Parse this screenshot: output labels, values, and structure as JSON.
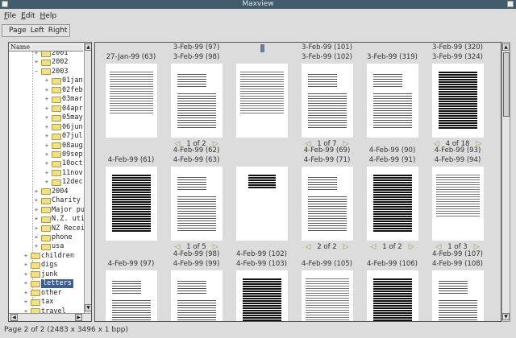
{
  "window": {
    "title": "Maxview"
  },
  "menu": [
    "File",
    "Edit",
    "Help"
  ],
  "toolbar": [
    "Page",
    "Left",
    "Right"
  ],
  "tree": {
    "header": "Name",
    "items": [
      {
        "label": "2001",
        "level": 2
      },
      {
        "label": "2002",
        "level": 2
      },
      {
        "label": "2003",
        "level": 2,
        "expanded": true
      },
      {
        "label": "01jan",
        "level": 3
      },
      {
        "label": "02feb",
        "level": 3
      },
      {
        "label": "03mar",
        "level": 3
      },
      {
        "label": "04apr",
        "level": 3
      },
      {
        "label": "05may",
        "level": 3
      },
      {
        "label": "06jun",
        "level": 3
      },
      {
        "label": "07jul",
        "level": 3
      },
      {
        "label": "08aug",
        "level": 3
      },
      {
        "label": "09sep",
        "level": 3
      },
      {
        "label": "10oct",
        "level": 3
      },
      {
        "label": "11nov",
        "level": 3
      },
      {
        "label": "12dec",
        "level": 3
      },
      {
        "label": "2004",
        "level": 2
      },
      {
        "label": "Charity",
        "level": 2
      },
      {
        "label": "Major pu",
        "level": 2
      },
      {
        "label": "N.Z. uti",
        "level": 2
      },
      {
        "label": "NZ Recei",
        "level": 2
      },
      {
        "label": "phone",
        "level": 2
      },
      {
        "label": "usa",
        "level": 2
      },
      {
        "label": "children",
        "level": 1
      },
      {
        "label": "digs",
        "level": 1
      },
      {
        "label": "junk",
        "level": 1
      },
      {
        "label": "letters",
        "level": 1,
        "selected": true
      },
      {
        "label": "other",
        "level": 1
      },
      {
        "label": "tax",
        "level": 1
      },
      {
        "label": "travel",
        "level": 1
      }
    ]
  },
  "grid": [
    [
      {
        "labels": [
          "27-Jan-99 (63)"
        ]
      },
      {
        "labels": [
          "3-Feb-99 (97)",
          "3-Feb-99 (98)"
        ],
        "nav": "1 of 2"
      },
      {
        "labels": []
      },
      {
        "labels": [
          "3-Feb-99 (101)",
          "3-Feb-99 (102)"
        ],
        "nav": "1 of 7"
      },
      {
        "labels": [
          "3-Feb-99 (319)"
        ]
      },
      {
        "labels": [
          "3-Feb-99 (320)",
          "3-Feb-99 (324)"
        ],
        "nav": "4 of 18"
      }
    ],
    [
      {
        "labels": [
          "4-Feb-99 (61)"
        ]
      },
      {
        "labels": [
          "4-Feb-99 (62)",
          "4-Feb-99 (63)"
        ],
        "nav": "1 of 5"
      },
      {
        "labels": []
      },
      {
        "labels": [
          "4-Feb-99 (69)",
          "4-Feb-99 (71)"
        ],
        "nav": "2 of 2"
      },
      {
        "labels": [
          "4-Feb-99 (90)",
          "4-Feb-99 (91)"
        ],
        "nav": "1 of 2"
      },
      {
        "labels": [
          "4-Feb-99 (93)",
          "4-Feb-99 (94)"
        ],
        "nav": "1 of 3"
      }
    ],
    [
      {
        "labels": [
          "4-Feb-99 (97)"
        ]
      },
      {
        "labels": [
          "4-Feb-99 (98)",
          "4-Feb-99 (99)"
        ]
      },
      {
        "labels": [
          "4-Feb-99 (102)",
          "4-Feb-99 (103)"
        ]
      },
      {
        "labels": [
          "4-Feb-99 (105)"
        ]
      },
      {
        "labels": [
          "4-Feb-99 (106)"
        ]
      },
      {
        "labels": [
          "4-Feb-99 (107)",
          "4-Feb-99 (108)"
        ]
      }
    ]
  ],
  "status": "Page 2 of 2   (2483 x 3496 x 1 bpp)",
  "colors": {
    "titlebar": "#3f5b6c",
    "selection": "#3e5f8e"
  }
}
